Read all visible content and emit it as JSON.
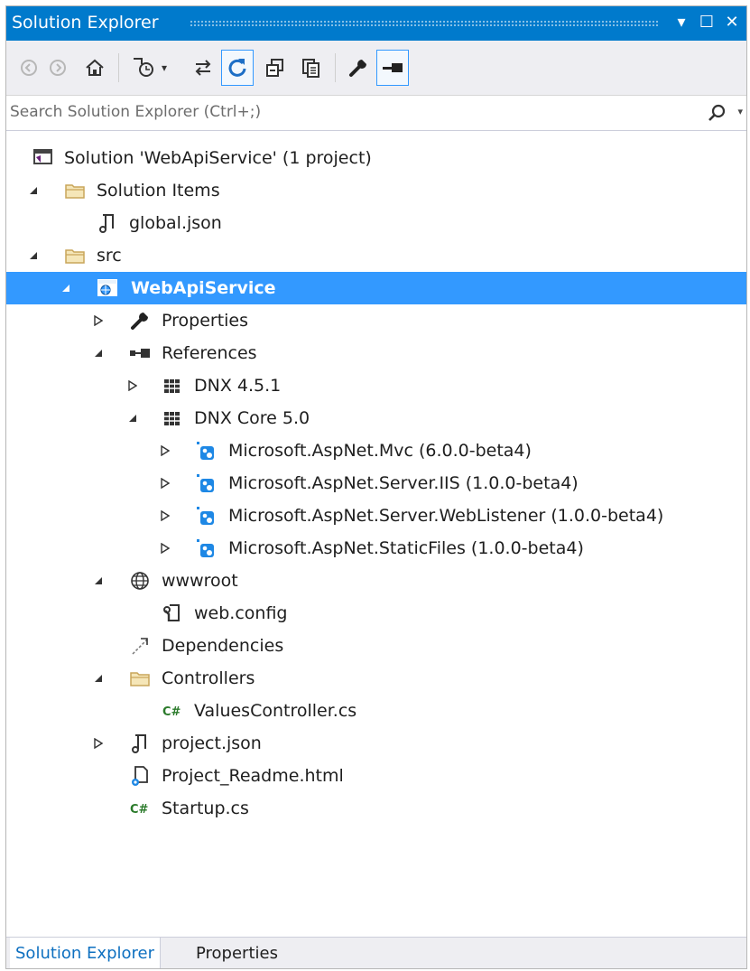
{
  "window": {
    "title": "Solution Explorer",
    "controls": {
      "dropdown": "▾",
      "maximize": "☐",
      "close": "✕"
    }
  },
  "toolbar": {
    "buttons": [
      {
        "name": "back",
        "icon": "back-arrow-icon"
      },
      {
        "name": "forward",
        "icon": "forward-arrow-icon"
      },
      {
        "name": "home",
        "icon": "home-icon"
      },
      {
        "name": "pending-changes-filter",
        "icon": "clock-filter-icon",
        "dropdown": "▾"
      },
      {
        "name": "sync-with-active-document",
        "icon": "sync-arrows-icon"
      },
      {
        "name": "refresh",
        "icon": "refresh-icon",
        "active": true
      },
      {
        "name": "collapse-all",
        "icon": "collapse-all-icon"
      },
      {
        "name": "show-all-files",
        "icon": "show-all-files-icon"
      },
      {
        "name": "properties",
        "icon": "wrench-icon"
      },
      {
        "name": "preview-selected-items",
        "icon": "preview-icon",
        "active": true
      }
    ]
  },
  "search": {
    "placeholder": "Search Solution Explorer (Ctrl+;)",
    "dropdown": "▾"
  },
  "tree": {
    "items": [
      {
        "label": "Solution 'WebApiService' (1 project)",
        "icon": "solution-icon",
        "expander": "none"
      },
      {
        "label": "Solution Items",
        "icon": "folder-icon",
        "expander": "expanded"
      },
      {
        "label": "global.json",
        "icon": "json-file-icon",
        "expander": "none"
      },
      {
        "label": "src",
        "icon": "folder-icon",
        "expander": "expanded"
      },
      {
        "label": "WebApiService",
        "icon": "web-project-icon",
        "expander": "expanded",
        "selected": true
      },
      {
        "label": "Properties",
        "icon": "wrench-icon",
        "expander": "collapsed"
      },
      {
        "label": "References",
        "icon": "references-icon",
        "expander": "expanded"
      },
      {
        "label": "DNX 4.5.1",
        "icon": "framework-library-icon",
        "expander": "collapsed"
      },
      {
        "label": "DNX Core 5.0",
        "icon": "framework-library-icon",
        "expander": "expanded"
      },
      {
        "label": "Microsoft.AspNet.Mvc (6.0.0-beta4)",
        "icon": "nuget-package-icon",
        "expander": "collapsed"
      },
      {
        "label": "Microsoft.AspNet.Server.IIS (1.0.0-beta4)",
        "icon": "nuget-package-icon",
        "expander": "collapsed"
      },
      {
        "label": "Microsoft.AspNet.Server.WebListener (1.0.0-beta4)",
        "icon": "nuget-package-icon",
        "expander": "collapsed"
      },
      {
        "label": "Microsoft.AspNet.StaticFiles (1.0.0-beta4)",
        "icon": "nuget-package-icon",
        "expander": "collapsed"
      },
      {
        "label": "wwwroot",
        "icon": "globe-icon",
        "expander": "expanded"
      },
      {
        "label": "web.config",
        "icon": "config-file-icon",
        "expander": "none"
      },
      {
        "label": "Dependencies",
        "icon": "dependencies-icon",
        "expander": "none"
      },
      {
        "label": "Controllers",
        "icon": "folder-icon",
        "expander": "expanded"
      },
      {
        "label": "ValuesController.cs",
        "icon": "csharp-file-icon",
        "expander": "none"
      },
      {
        "label": "project.json",
        "icon": "json-file-icon",
        "expander": "collapsed"
      },
      {
        "label": "Project_Readme.html",
        "icon": "html-file-icon",
        "expander": "none"
      },
      {
        "label": "Startup.cs",
        "icon": "csharp-file-icon",
        "expander": "none"
      }
    ]
  },
  "tabs": [
    {
      "label": "Solution Explorer",
      "active": true
    },
    {
      "label": "Properties",
      "active": false
    }
  ],
  "colors": {
    "accent": "#007acc",
    "selection": "#3399ff",
    "panel": "#eeeef2",
    "folder": "#dcb67a",
    "package": "#1e88e5"
  }
}
